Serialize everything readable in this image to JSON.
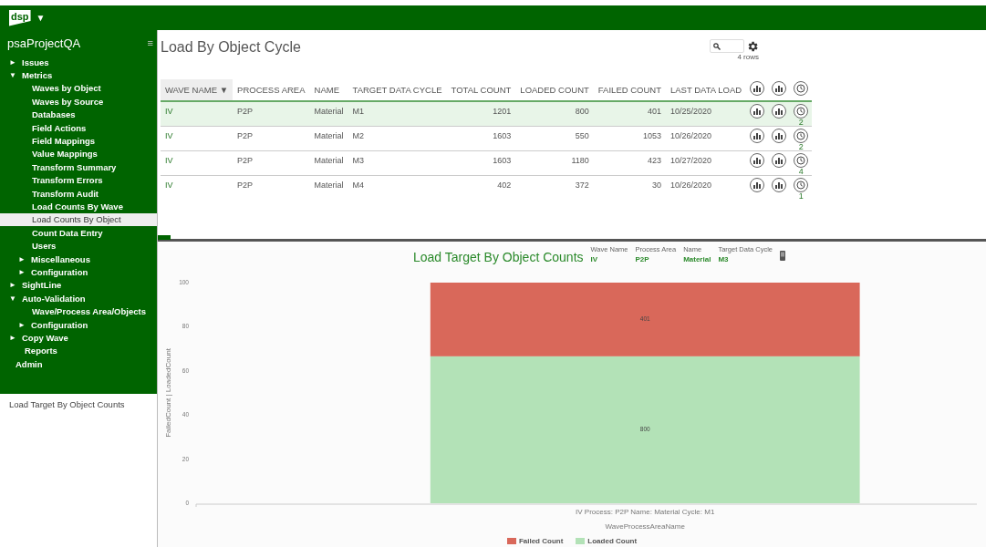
{
  "app": {
    "logo": "dsp",
    "menu_caret": "▼"
  },
  "sidebar": {
    "project": "psaProjectQA",
    "menu_glyph": "≡",
    "footer": "Load Target By Object Counts",
    "items": [
      {
        "label": "Issues",
        "kind": "group",
        "arrow": "►",
        "selected": false
      },
      {
        "label": "Metrics",
        "kind": "group",
        "arrow": "▼",
        "selected": false,
        "children": [
          {
            "label": "Waves by Object",
            "kind": "link",
            "selected": false
          },
          {
            "label": "Waves by Source",
            "kind": "link",
            "selected": false
          },
          {
            "label": "Databases",
            "kind": "link",
            "selected": false
          },
          {
            "label": "Field Actions",
            "kind": "link",
            "selected": false
          },
          {
            "label": "Field Mappings",
            "kind": "link",
            "selected": false
          },
          {
            "label": "Value Mappings",
            "kind": "link",
            "selected": false
          },
          {
            "label": "Transform Summary",
            "kind": "link",
            "selected": false
          },
          {
            "label": "Transform Errors",
            "kind": "link",
            "selected": false
          },
          {
            "label": "Transform Audit",
            "kind": "link",
            "selected": false
          },
          {
            "label": "Load Counts By Wave",
            "kind": "link",
            "selected": false
          },
          {
            "label": "Load Counts By Object",
            "kind": "link",
            "selected": true
          },
          {
            "label": "Count Data Entry",
            "kind": "link",
            "selected": false
          },
          {
            "label": "Users",
            "kind": "link",
            "selected": false
          },
          {
            "label": "Miscellaneous",
            "kind": "group",
            "arrow": "►",
            "selected": false
          },
          {
            "label": "Configuration",
            "kind": "group",
            "arrow": "►",
            "selected": false
          }
        ]
      },
      {
        "label": "SightLine",
        "kind": "group",
        "arrow": "►",
        "selected": false
      },
      {
        "label": "Auto-Validation",
        "kind": "group",
        "arrow": "▼",
        "selected": false,
        "children": [
          {
            "label": "Wave/Process Area/Objects",
            "kind": "link",
            "selected": false
          },
          {
            "label": "Configuration",
            "kind": "group",
            "arrow": "►",
            "selected": false
          }
        ]
      },
      {
        "label": "Copy Wave",
        "kind": "group",
        "arrow": "►",
        "selected": false
      },
      {
        "label": "Reports",
        "kind": "link",
        "selected": false
      },
      {
        "label": "Admin",
        "kind": "label",
        "selected": false
      }
    ]
  },
  "grid": {
    "title": "Load By Object Cycle",
    "row_count": "4 rows",
    "columns": [
      {
        "label": "WAVE NAME",
        "sorted": true,
        "sort_glyph": "▼",
        "kind": "text"
      },
      {
        "label": "PROCESS AREA",
        "sorted": false,
        "kind": "text"
      },
      {
        "label": "NAME",
        "sorted": false,
        "kind": "text"
      },
      {
        "label": "TARGET DATA CYCLE",
        "sorted": false,
        "kind": "text"
      },
      {
        "label": "TOTAL COUNT",
        "sorted": false,
        "kind": "number"
      },
      {
        "label": "LOADED COUNT",
        "sorted": false,
        "kind": "number"
      },
      {
        "label": "FAILED COUNT",
        "sorted": false,
        "kind": "number"
      },
      {
        "label": "LAST DATA LOAD",
        "sorted": false,
        "kind": "text"
      }
    ],
    "rows": [
      {
        "selected": true,
        "cells": [
          "IV",
          "P2P",
          "Material",
          "M1",
          "1201",
          "800",
          "401",
          "10/25/2020"
        ],
        "history_count": "2"
      },
      {
        "selected": false,
        "cells": [
          "IV",
          "P2P",
          "Material",
          "M2",
          "1603",
          "550",
          "1053",
          "10/26/2020"
        ],
        "history_count": "2"
      },
      {
        "selected": false,
        "cells": [
          "IV",
          "P2P",
          "Material",
          "M3",
          "1603",
          "1180",
          "423",
          "10/27/2020"
        ],
        "history_count": "4"
      },
      {
        "selected": false,
        "cells": [
          "IV",
          "P2P",
          "Material",
          "M4",
          "402",
          "372",
          "30",
          "10/26/2020"
        ],
        "history_count": "1"
      }
    ]
  },
  "chart_panel": {
    "title": "Load Target By Object Counts",
    "filters": [
      {
        "label": "Wave Name",
        "value": "IV"
      },
      {
        "label": "Process Area",
        "value": "P2P"
      },
      {
        "label": "Name",
        "value": "Material"
      },
      {
        "label": "Target Data Cycle",
        "value": "M3"
      }
    ],
    "chart_data": {
      "type": "bar",
      "stacked": true,
      "xlabel": "WaveProcessAreaName",
      "ylabel": "FailedCount | LoadedCount",
      "categories": [
        "IV Process: P2P Name: Material Cycle: M1"
      ],
      "ylim": [
        0,
        100
      ],
      "yticks": [
        0,
        20,
        40,
        60,
        80,
        100
      ],
      "series": [
        {
          "name": "Loaded Count",
          "color": "#b3e2b7",
          "values": [
            66.6
          ]
        },
        {
          "name": "Failed Count",
          "color": "#d9685a",
          "values": [
            33.4
          ]
        }
      ],
      "value_labels": [
        [
          "800"
        ],
        [
          "401"
        ]
      ]
    }
  }
}
